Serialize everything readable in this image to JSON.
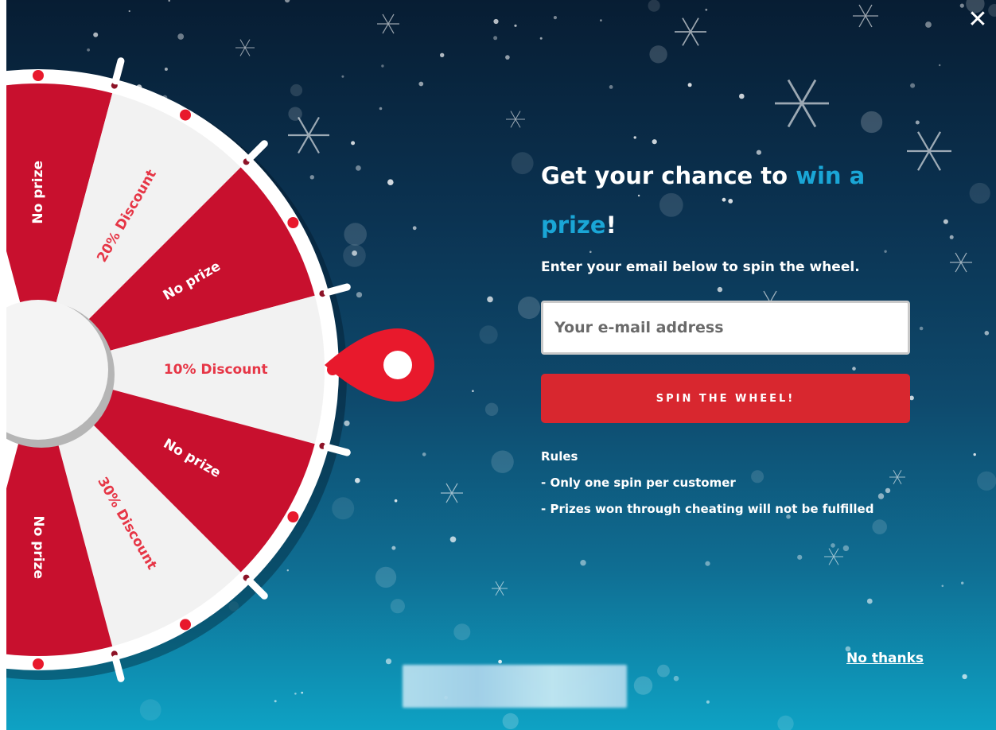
{
  "window": {
    "close_label": "✕"
  },
  "wheel": {
    "segments": [
      {
        "label": "No prize",
        "fill": "#c8102e",
        "text_color": "#ffffff"
      },
      {
        "label": "20% Discount",
        "fill": "#f2f2f2",
        "text_color": "#e63646"
      },
      {
        "label": "No prize",
        "fill": "#c8102e",
        "text_color": "#ffffff"
      },
      {
        "label": "10% Discount",
        "fill": "#f2f2f2",
        "text_color": "#e63646"
      },
      {
        "label": "No prize",
        "fill": "#c8102e",
        "text_color": "#ffffff"
      },
      {
        "label": "30% Discount",
        "fill": "#f2f2f2",
        "text_color": "#e63646"
      },
      {
        "label": "No prize",
        "fill": "#c8102e",
        "text_color": "#ffffff"
      }
    ],
    "pointer_color": "#e8192c"
  },
  "content": {
    "headline_part1": "Get your chance to ",
    "headline_accent1": "win a",
    "headline_accent2": "prize",
    "headline_end": "!",
    "subheadline": "Enter your email below to spin the wheel.",
    "email_placeholder": "Your e-mail address",
    "spin_button_label": "SPIN THE WHEEL!",
    "rules_title": "Rules",
    "rule_1": "- Only one spin per customer",
    "rule_2": "- Prizes won through cheating will not be fulfilled",
    "accent_color": "#1aa6d6",
    "button_color": "#d8272f"
  },
  "footer": {
    "no_thanks_label": "No thanks"
  }
}
